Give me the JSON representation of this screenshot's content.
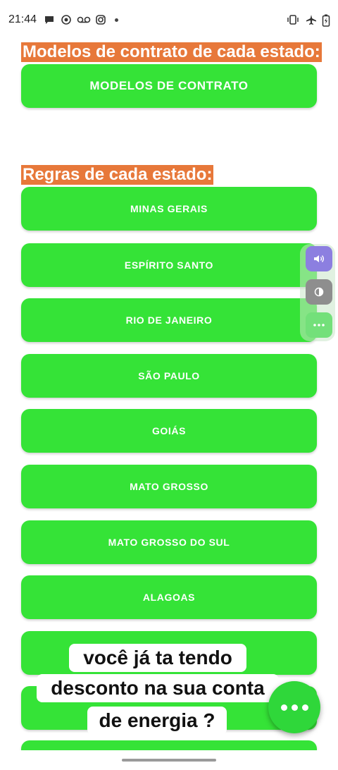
{
  "status_bar": {
    "time": "21:44",
    "left_icons": [
      "chat-bubble-icon",
      "record-icon",
      "voicemail-icon",
      "instagram-icon"
    ],
    "right_icons": [
      "vibrate-icon",
      "airplane-mode-icon",
      "battery-icon"
    ]
  },
  "contracts_section": {
    "title": "Modelos de contrato de cada estado:",
    "button_label": "MODELOS DE CONTRATO"
  },
  "rules_section": {
    "title": "Regras de cada estado:",
    "states": [
      "MINAS GERAIS",
      "ESPÍRITO SANTO",
      "RIO DE JANEIRO",
      "SÃO PAULO",
      "GOIÁS",
      "MATO GROSSO",
      "MATO GROSSO DO SUL",
      "ALAGOAS"
    ]
  },
  "accessibility_widget": {
    "buttons": [
      "speaker-icon",
      "contrast-icon",
      "more-options-icon"
    ]
  },
  "caption": {
    "lines": [
      "você já ta tendo",
      "desconto na sua conta",
      "de energia ?"
    ]
  },
  "fab": {
    "icon": "more-horizontal-icon"
  },
  "colors": {
    "accent_green": "#35e337",
    "title_orange": "#e7783a",
    "widget_purple": "#8c7fe0",
    "widget_gray": "#8e8e8e"
  }
}
